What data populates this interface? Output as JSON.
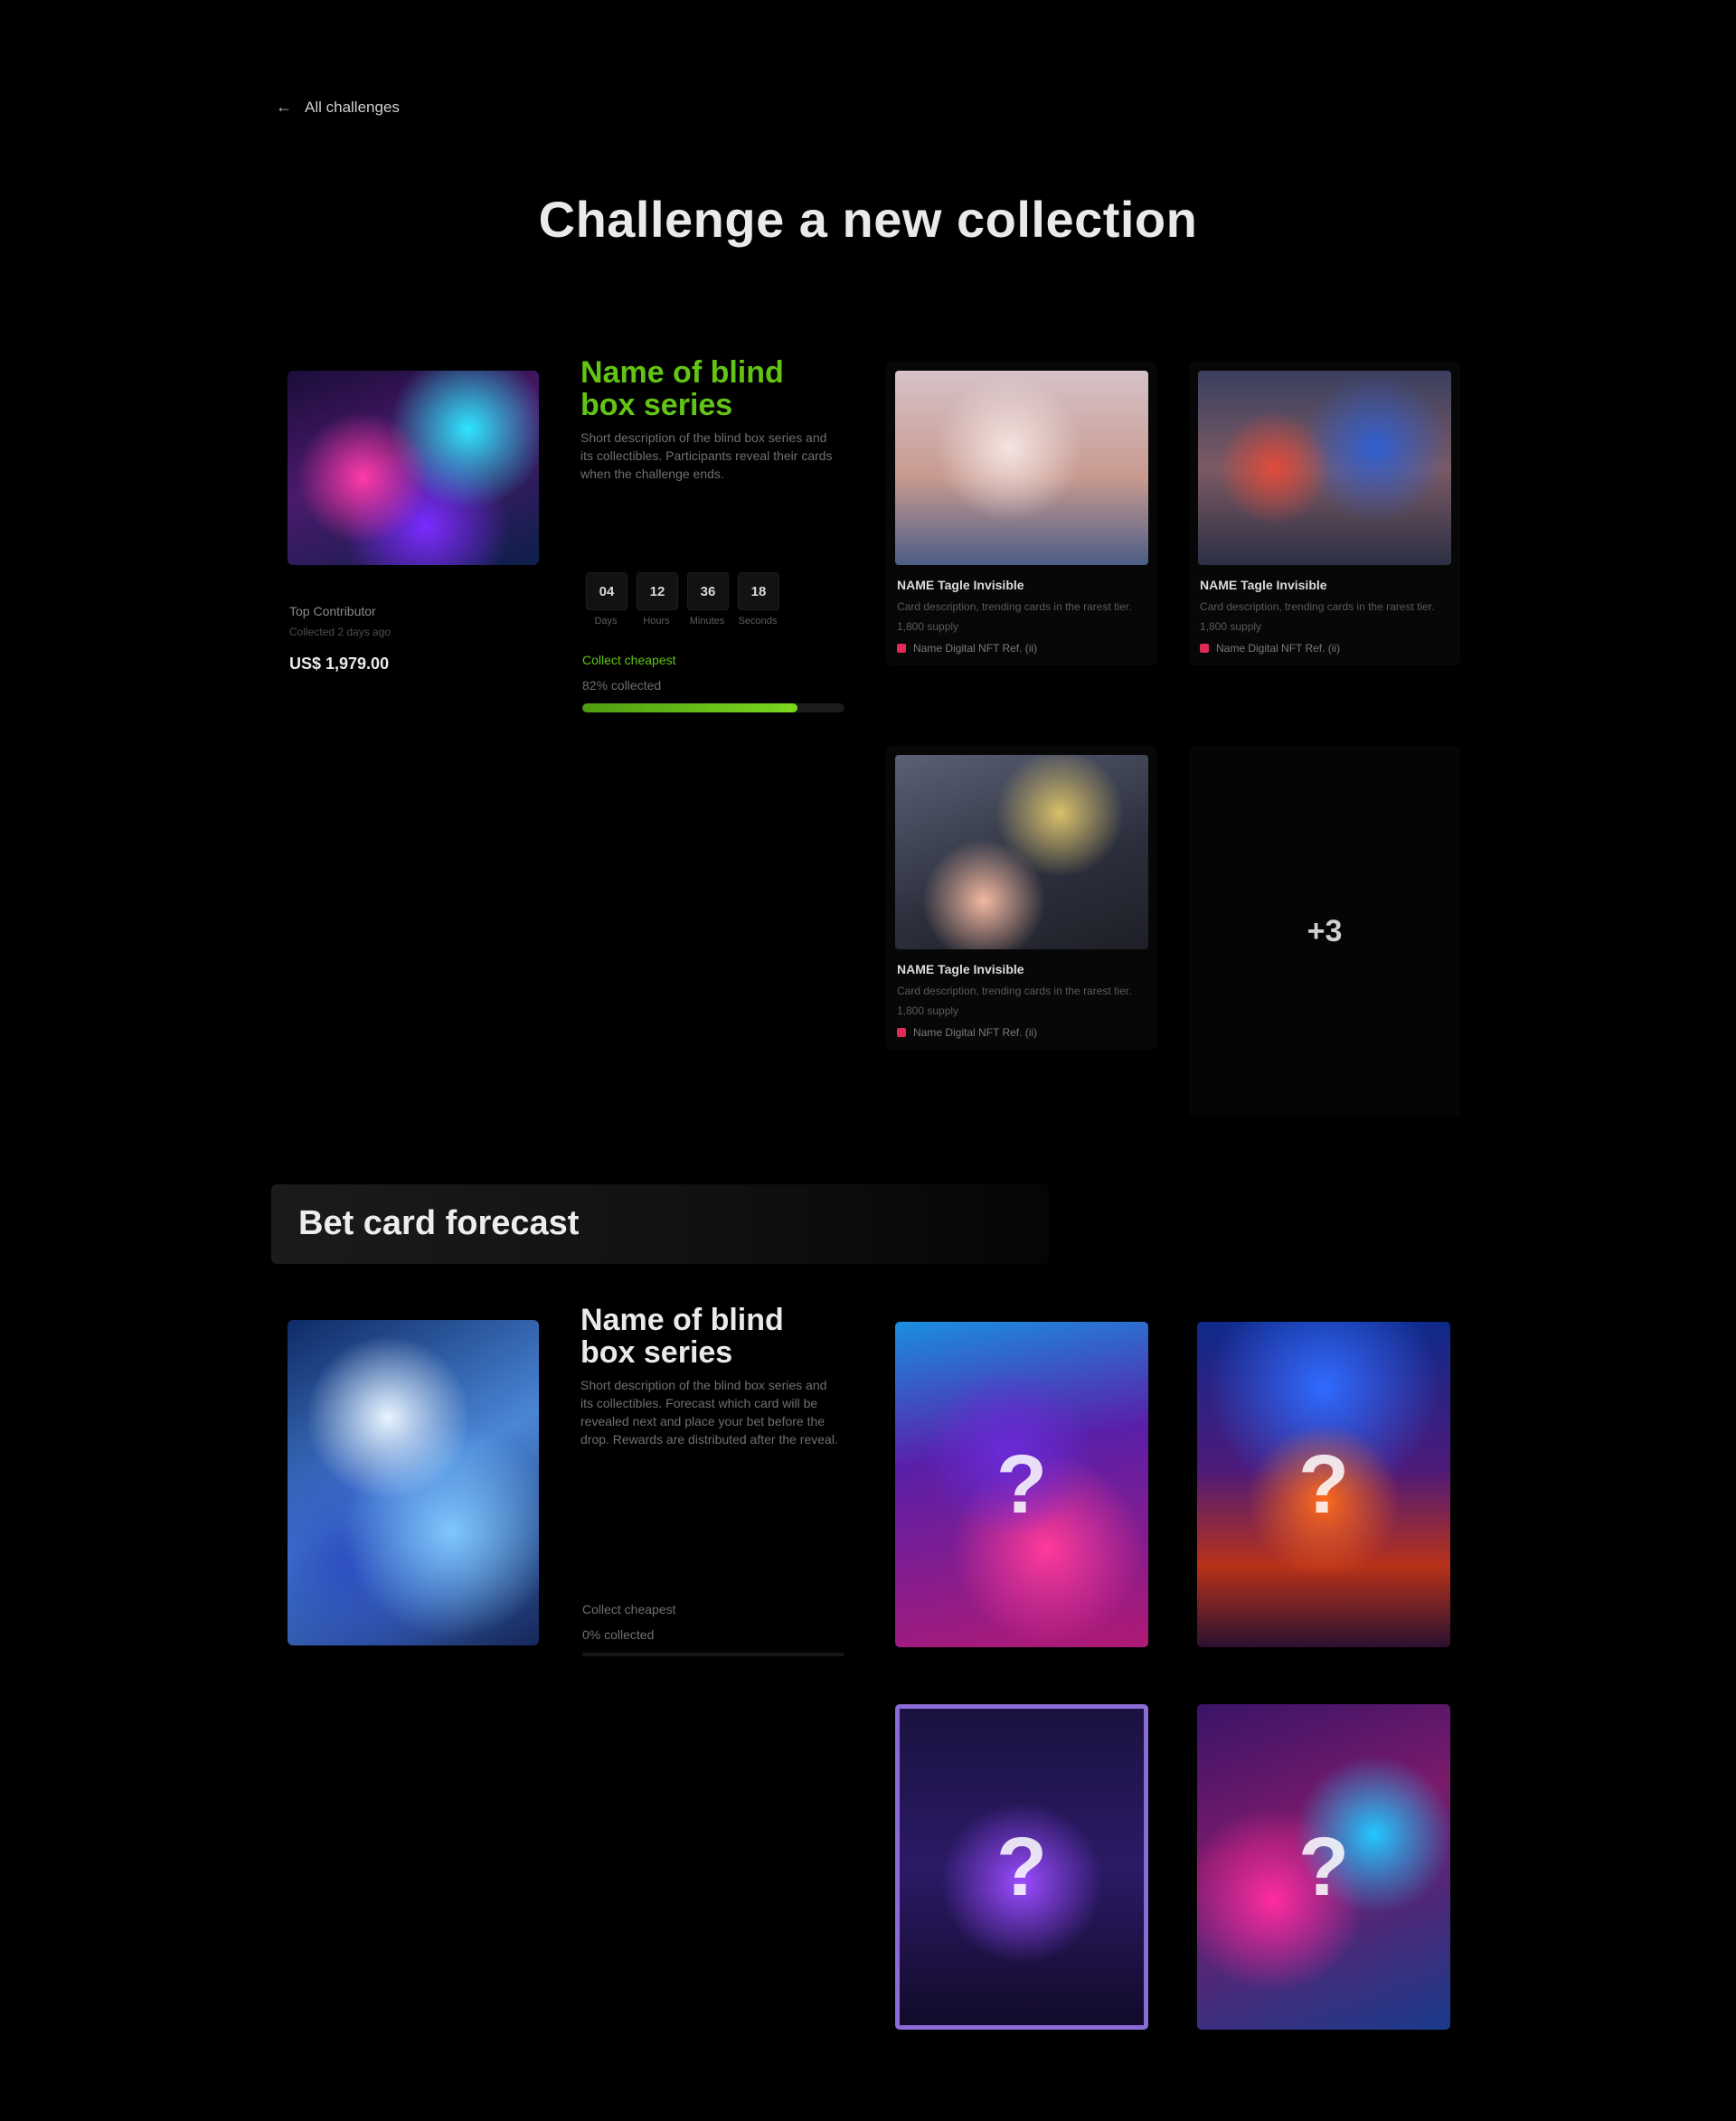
{
  "nav": {
    "back_label": "All challenges",
    "back_icon": "arrow-left-icon"
  },
  "page": {
    "title": "Challenge a new collection"
  },
  "challenge": {
    "series": {
      "title": "Name of blind box series",
      "description": "Short description of the blind box series and its collectibles. Participants reveal their cards when the challenge ends.",
      "creator_label": "Top Contributor",
      "creator_meta": "Collected 2 days ago",
      "price": "US$ 1,979.00",
      "countdown": [
        {
          "value": "04",
          "label": "Days"
        },
        {
          "value": "12",
          "label": "Hours"
        },
        {
          "value": "36",
          "label": "Minutes"
        },
        {
          "value": "18",
          "label": "Seconds"
        }
      ],
      "status": "Collect cheapest",
      "collected_label": "82% collected",
      "progress_fraction": 0.82
    },
    "cards": [
      {
        "name": "NAME Tagle Invisible",
        "description": "Card description, trending cards in the rarest tier.",
        "meta": "1,800 supply",
        "owner": "Name Digital NFT Ref. (ii)"
      },
      {
        "name": "NAME Tagle Invisible",
        "description": "Card description, trending cards in the rarest tier.",
        "meta": "1,800 supply",
        "owner": "Name Digital NFT Ref. (ii)"
      },
      {
        "name": "NAME Tagle Invisible",
        "description": "Card description, trending cards in the rarest tier.",
        "meta": "1,800 supply",
        "owner": "Name Digital NFT Ref. (ii)"
      }
    ],
    "more_label": "+3"
  },
  "bet": {
    "title": "Bet card forecast",
    "series": {
      "title": "Name of blind box series",
      "description": "Short description of the blind box series and its collectibles. Forecast which card will be revealed next and place your bet before the drop. Rewards are distributed after the reveal.",
      "status": "Collect cheapest",
      "collected_label": "0% collected",
      "progress_fraction": 0.0
    },
    "posters": [
      {
        "icon": "question-mark-icon",
        "symbol": "?"
      },
      {
        "icon": "question-mark-icon",
        "symbol": "?"
      },
      {
        "icon": "question-mark-icon",
        "symbol": "?"
      },
      {
        "icon": "question-mark-icon",
        "symbol": "?"
      }
    ]
  },
  "colors": {
    "accent_green": "#63c414",
    "owner_dot": "#e02b58",
    "background": "#000000"
  }
}
